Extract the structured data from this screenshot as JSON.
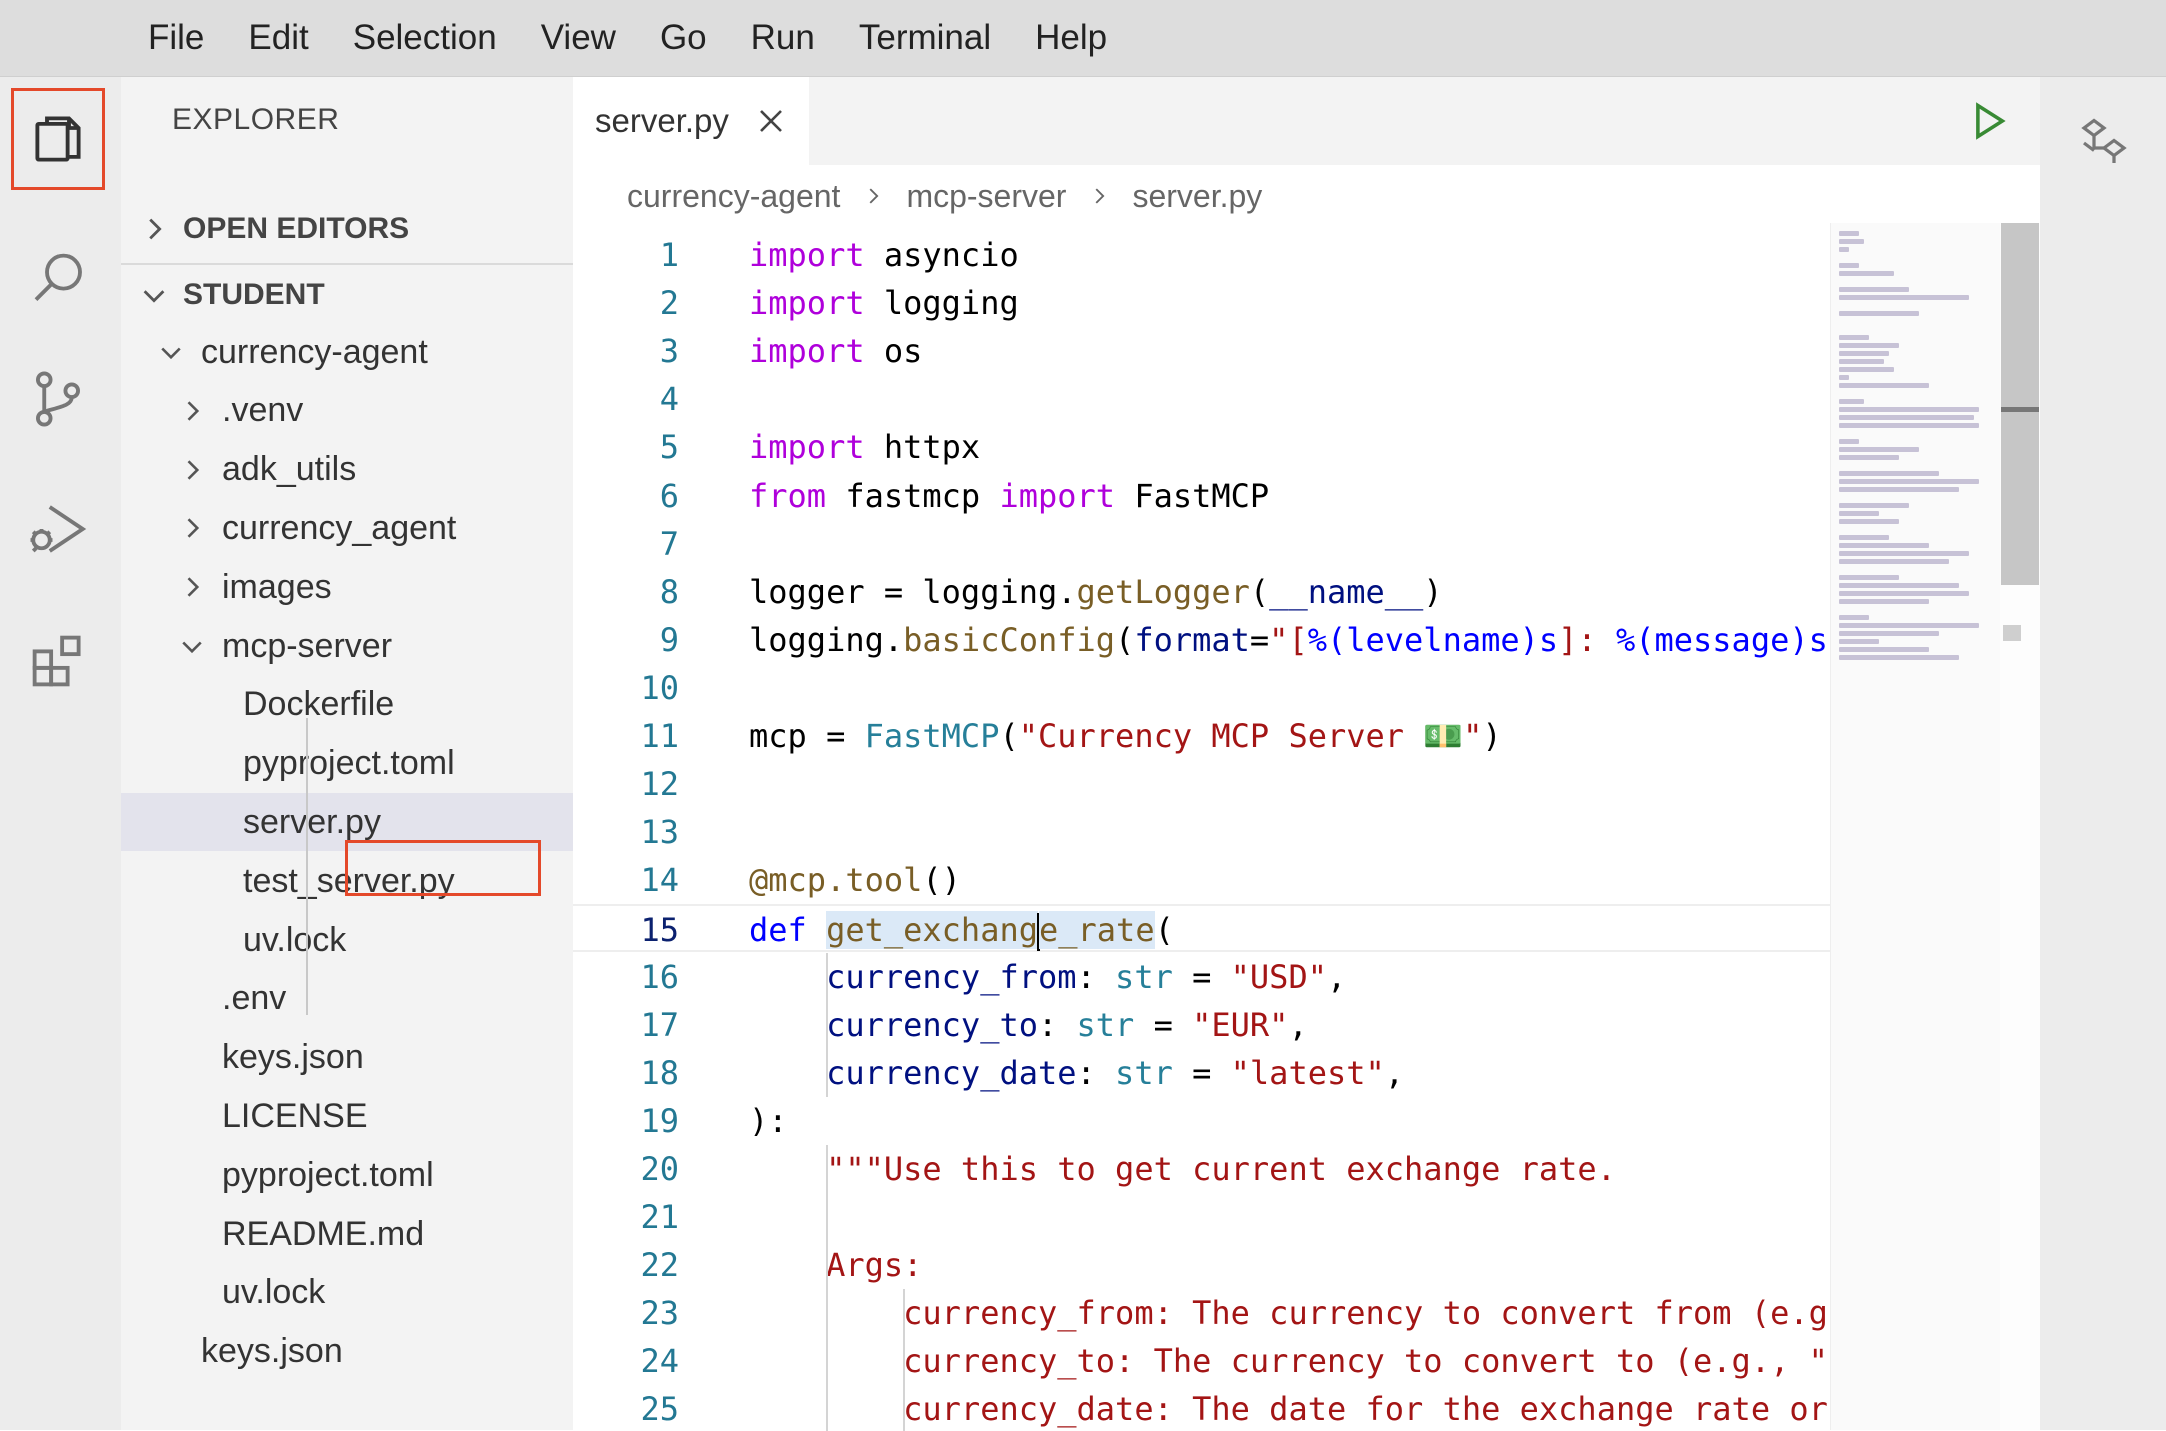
{
  "menu": [
    "File",
    "Edit",
    "Selection",
    "View",
    "Go",
    "Run",
    "Terminal",
    "Help"
  ],
  "activity_bar": [
    {
      "name": "explorer-icon",
      "active": true
    },
    {
      "name": "search-icon",
      "active": false
    },
    {
      "name": "source-control-icon",
      "active": false
    },
    {
      "name": "run-debug-icon",
      "active": false
    },
    {
      "name": "extensions-icon",
      "active": false
    }
  ],
  "sidebar": {
    "title": "EXPLORER",
    "open_editors": "OPEN EDITORS",
    "workspace": "STUDENT",
    "tree": [
      {
        "label": "currency-agent",
        "depth": 0,
        "chevron": "down"
      },
      {
        "label": ".venv",
        "depth": 1,
        "chevron": "right"
      },
      {
        "label": "adk_utils",
        "depth": 1,
        "chevron": "right"
      },
      {
        "label": "currency_agent",
        "depth": 1,
        "chevron": "right"
      },
      {
        "label": "images",
        "depth": 1,
        "chevron": "right"
      },
      {
        "label": "mcp-server",
        "depth": 1,
        "chevron": "down"
      },
      {
        "label": "Dockerfile",
        "depth": 2,
        "chevron": ""
      },
      {
        "label": "pyproject.toml",
        "depth": 2,
        "chevron": ""
      },
      {
        "label": "server.py",
        "depth": 2,
        "chevron": "",
        "selected": true
      },
      {
        "label": "test_server.py",
        "depth": 2,
        "chevron": ""
      },
      {
        "label": "uv.lock",
        "depth": 2,
        "chevron": ""
      },
      {
        "label": ".env",
        "depth": 1,
        "chevron": ""
      },
      {
        "label": "keys.json",
        "depth": 1,
        "chevron": ""
      },
      {
        "label": "LICENSE",
        "depth": 1,
        "chevron": ""
      },
      {
        "label": "pyproject.toml",
        "depth": 1,
        "chevron": ""
      },
      {
        "label": "README.md",
        "depth": 1,
        "chevron": ""
      },
      {
        "label": "uv.lock",
        "depth": 1,
        "chevron": ""
      },
      {
        "label": "keys.json",
        "depth": 0,
        "chevron": ""
      }
    ]
  },
  "editor": {
    "tab_label": "server.py",
    "breadcrumb": [
      "currency-agent",
      "mcp-server",
      "server.py"
    ],
    "active_line": 15,
    "lines": [
      [
        {
          "t": "import",
          "c": "kw"
        },
        {
          "t": " asyncio"
        }
      ],
      [
        {
          "t": "import",
          "c": "kw"
        },
        {
          "t": " logging"
        }
      ],
      [
        {
          "t": "import",
          "c": "kw"
        },
        {
          "t": " os"
        }
      ],
      [],
      [
        {
          "t": "import",
          "c": "kw"
        },
        {
          "t": " httpx"
        }
      ],
      [
        {
          "t": "from",
          "c": "kw"
        },
        {
          "t": " fastmcp "
        },
        {
          "t": "import",
          "c": "kw"
        },
        {
          "t": " FastMCP"
        }
      ],
      [],
      [
        {
          "t": "logger = logging."
        },
        {
          "t": "getLogger",
          "c": "fn"
        },
        {
          "t": "("
        },
        {
          "t": "__name__",
          "c": "vr"
        },
        {
          "t": ")"
        }
      ],
      [
        {
          "t": "logging."
        },
        {
          "t": "basicConfig",
          "c": "fn"
        },
        {
          "t": "("
        },
        {
          "t": "format",
          "c": "vr"
        },
        {
          "t": "="
        },
        {
          "t": "\"[",
          "c": "str"
        },
        {
          "t": "%(levelname)s",
          "c": "kd"
        },
        {
          "t": "]: ",
          "c": "str"
        },
        {
          "t": "%(message)s",
          "c": "kd"
        },
        {
          "t": "\"",
          "c": "str"
        }
      ],
      [],
      [
        {
          "t": "mcp = "
        },
        {
          "t": "FastMCP",
          "c": "tp"
        },
        {
          "t": "("
        },
        {
          "t": "\"Currency MCP Server 💵\"",
          "c": "str"
        },
        {
          "t": ")"
        }
      ],
      [],
      [],
      [
        {
          "t": "@mcp.tool",
          "c": "fn"
        },
        {
          "t": "()"
        }
      ],
      [
        {
          "t": "def",
          "c": "kd"
        },
        {
          "t": " "
        },
        {
          "t": "get_exchang",
          "c": "fn sel"
        },
        {
          "t": "",
          "c": "cursor"
        },
        {
          "t": "e_rate",
          "c": "fn sel"
        },
        {
          "t": "("
        }
      ],
      [
        {
          "t": "    "
        },
        {
          "t": "currency_from",
          "c": "vr"
        },
        {
          "t": ": "
        },
        {
          "t": "str",
          "c": "tp"
        },
        {
          "t": " = "
        },
        {
          "t": "\"USD\"",
          "c": "str"
        },
        {
          "t": ","
        }
      ],
      [
        {
          "t": "    "
        },
        {
          "t": "currency_to",
          "c": "vr"
        },
        {
          "t": ": "
        },
        {
          "t": "str",
          "c": "tp"
        },
        {
          "t": " = "
        },
        {
          "t": "\"EUR\"",
          "c": "str"
        },
        {
          "t": ","
        }
      ],
      [
        {
          "t": "    "
        },
        {
          "t": "currency_date",
          "c": "vr"
        },
        {
          "t": ": "
        },
        {
          "t": "str",
          "c": "tp"
        },
        {
          "t": " = "
        },
        {
          "t": "\"latest\"",
          "c": "str"
        },
        {
          "t": ","
        }
      ],
      [
        {
          "t": ")"
        },
        {
          "t": ":"
        }
      ],
      [
        {
          "t": "    "
        },
        {
          "t": "\"\"\"Use this to get current exchange rate.",
          "c": "str"
        }
      ],
      [],
      [
        {
          "t": "    "
        },
        {
          "t": "Args:",
          "c": "str"
        }
      ],
      [
        {
          "t": "        "
        },
        {
          "t": "currency_from: The currency to convert from (e.g",
          "c": "str"
        }
      ],
      [
        {
          "t": "        "
        },
        {
          "t": "currency_to: The currency to convert to (e.g., \"",
          "c": "str"
        }
      ],
      [
        {
          "t": "        "
        },
        {
          "t": "currency_date: The date for the exchange rate or",
          "c": "str"
        }
      ]
    ]
  }
}
